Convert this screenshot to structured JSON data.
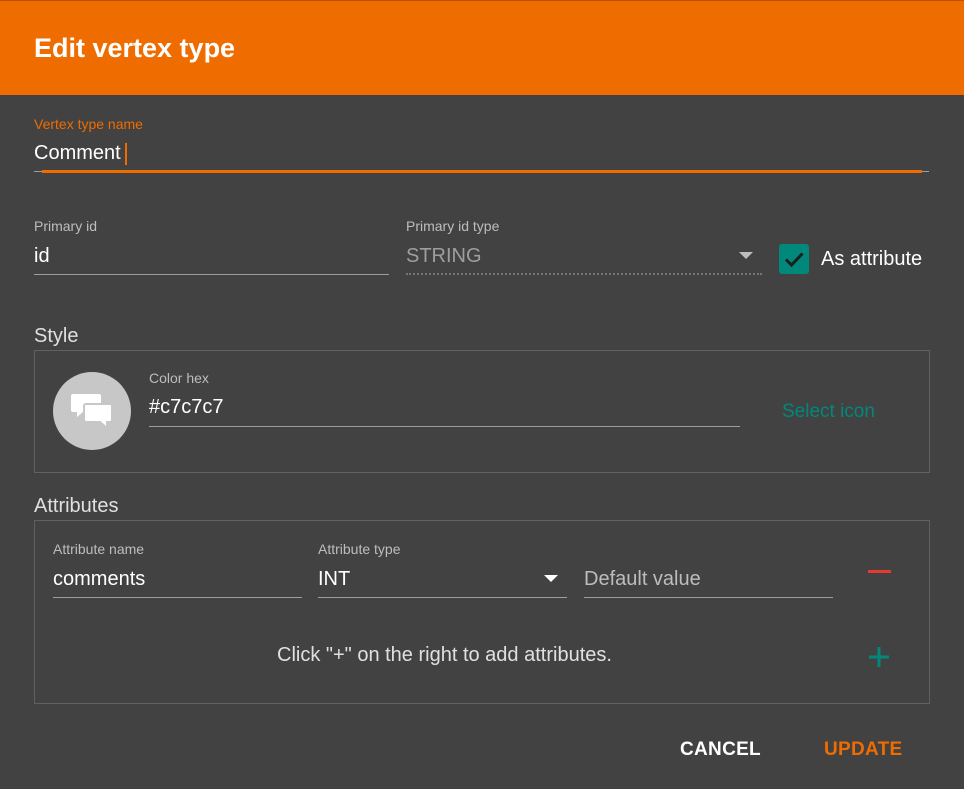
{
  "dialog": {
    "title": "Edit vertex type"
  },
  "name_field": {
    "label": "Vertex type name",
    "value": "Comment"
  },
  "primary_id": {
    "label": "Primary id",
    "value": "id"
  },
  "primary_id_type": {
    "label": "Primary id type",
    "value": "STRING"
  },
  "as_attribute": {
    "label": "As attribute",
    "checked": true
  },
  "style": {
    "title": "Style",
    "color_label": "Color hex",
    "color_value": "#c7c7c7",
    "select_icon_label": "Select icon",
    "icon": "comments-icon"
  },
  "attributes": {
    "title": "Attributes",
    "rows": [
      {
        "name_label": "Attribute name",
        "name_value": "comments",
        "type_label": "Attribute type",
        "type_value": "INT",
        "default_placeholder": "Default value"
      }
    ],
    "hint": "Click \"+\" on the right to add attributes."
  },
  "actions": {
    "cancel": "CANCEL",
    "update": "UPDATE"
  },
  "colors": {
    "accent": "#ef6c00",
    "teal": "#00897b",
    "remove": "#e53935",
    "background": "#424242"
  }
}
